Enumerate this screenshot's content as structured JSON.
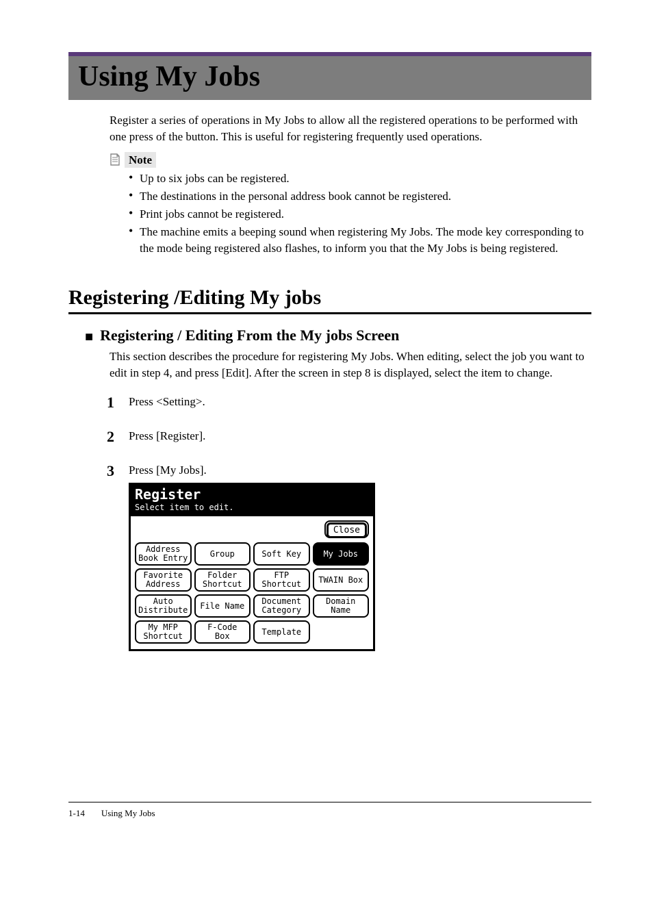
{
  "h1": "Using My Jobs",
  "intro": "Register a series of operations in My Jobs to allow all the registered operations to be performed with one press of the button. This is useful for registering frequently used operations.",
  "note_label": "Note",
  "notes": [
    "Up to six jobs can be registered.",
    "The destinations in the personal address book cannot be registered.",
    "Print jobs cannot be registered.",
    "The machine emits a beeping sound when registering My Jobs. The mode key corresponding to the mode being registered also flashes, to inform you that the My Jobs is being registered."
  ],
  "h2": "Registering /Editing My jobs",
  "h3": "Registering / Editing From the My jobs Screen",
  "h3_body": "This section describes the procedure for registering My Jobs. When editing, select the job you want to edit in step 4, and press [Edit]. After the screen in step 8 is displayed, select the item to change.",
  "steps": [
    "Press <Setting>.",
    "Press [Register].",
    "Press [My Jobs]."
  ],
  "device": {
    "title": "Register",
    "subtitle": "Select item to edit.",
    "close": "Close",
    "buttons": [
      {
        "label": "Address\nBook Entry",
        "selected": false
      },
      {
        "label": "Group",
        "selected": false
      },
      {
        "label": "Soft Key",
        "selected": false
      },
      {
        "label": "My Jobs",
        "selected": true
      },
      {
        "label": "Favorite\nAddress",
        "selected": false
      },
      {
        "label": "Folder\nShortcut",
        "selected": false
      },
      {
        "label": "FTP\nShortcut",
        "selected": false
      },
      {
        "label": "TWAIN Box",
        "selected": false
      },
      {
        "label": "Auto\nDistribute",
        "selected": false
      },
      {
        "label": "File Name",
        "selected": false
      },
      {
        "label": "Document\nCategory",
        "selected": false
      },
      {
        "label": "Domain\nName",
        "selected": false
      },
      {
        "label": "My MFP\nShortcut",
        "selected": false
      },
      {
        "label": "F-Code\nBox",
        "selected": false
      },
      {
        "label": "Template",
        "selected": false
      },
      {
        "label": "",
        "selected": false,
        "empty": true
      }
    ]
  },
  "footer_page": "1-14",
  "footer_title": "Using My Jobs"
}
